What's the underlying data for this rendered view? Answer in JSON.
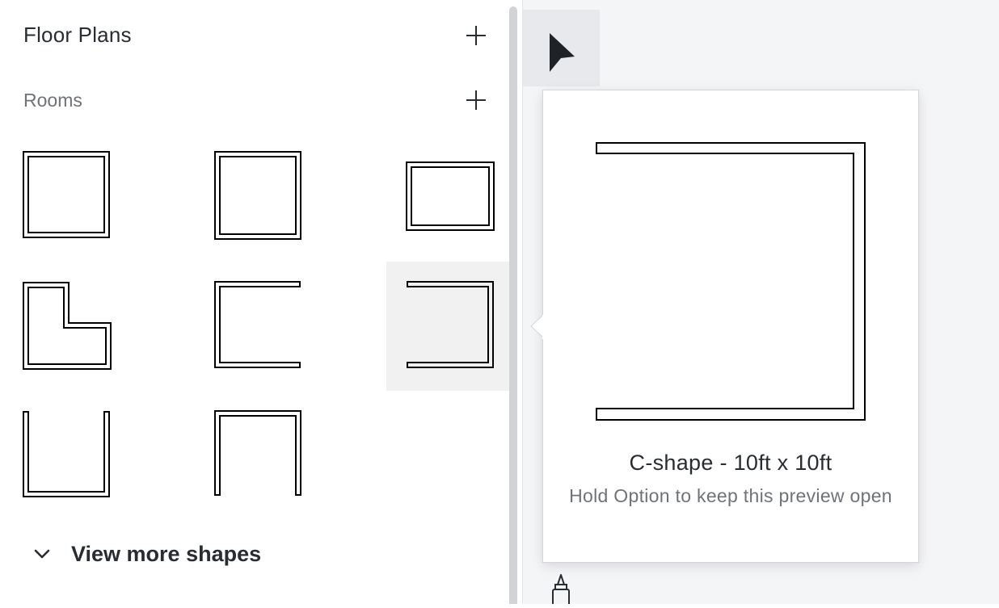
{
  "sidebar": {
    "title": "Floor Plans",
    "section_title": "Rooms",
    "add_library_icon": "plus-icon",
    "add_section_icon": "plus-icon",
    "view_more_label": "View more shapes",
    "view_more_icon": "chevron-down-icon"
  },
  "tools": {
    "pointer_icon": "cursor-arrow-icon",
    "marker_icon": "marker-icon"
  },
  "preview": {
    "title": "C-shape - 10ft x 10ft",
    "hint": "Hold Option to keep this preview open"
  },
  "colors": {
    "selected_tile_bg": "#f1f1f2",
    "canvas_bg": "#f4f5f7",
    "text_primary": "#282c33",
    "text_secondary": "#6f7379"
  }
}
